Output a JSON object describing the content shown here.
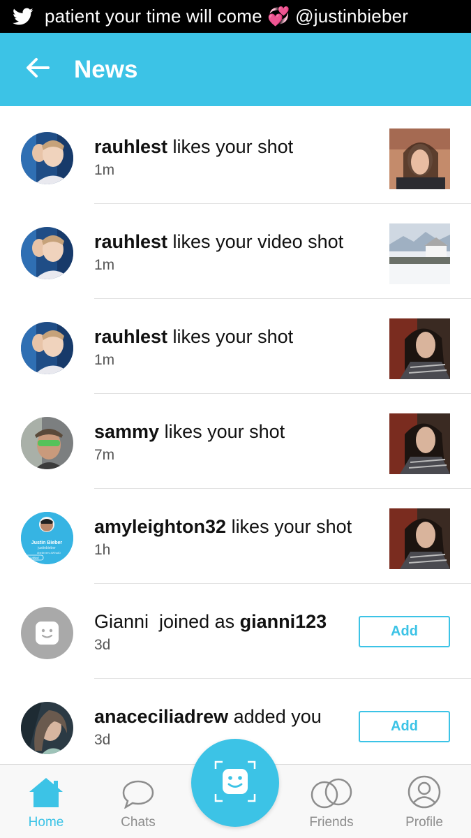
{
  "status_bar": {
    "icon": "twitter-bird-icon",
    "text": "patient your time will come 💞 @justinbieber"
  },
  "header": {
    "back_icon": "arrow-left-icon",
    "title": "News"
  },
  "feed": [
    {
      "user": "rauhlest",
      "action": " likes your shot",
      "time": "1m",
      "avatar": "photo-avatar",
      "trailing": "thumbnail"
    },
    {
      "user": "rauhlest",
      "action": " likes your video shot",
      "time": "1m",
      "avatar": "photo-avatar",
      "trailing": "thumbnail"
    },
    {
      "user": "rauhlest",
      "action": " likes your shot",
      "time": "1m",
      "avatar": "photo-avatar",
      "trailing": "thumbnail"
    },
    {
      "user": "sammy",
      "action": " likes your shot",
      "time": "7m",
      "avatar": "photo-avatar",
      "trailing": "thumbnail"
    },
    {
      "user": "amyleighton32",
      "action": " likes your shot",
      "time": "1h",
      "avatar": "photo-avatar",
      "trailing": "thumbnail",
      "avatar_text": {
        "name": "Justin Bieber",
        "handle": "justinbieber",
        "tag": "#believers #WhatD",
        "badge": "Added"
      }
    },
    {
      "prefix": "Gianni  joined as ",
      "user": "gianni123",
      "time": "3d",
      "avatar": "default-smiley-avatar",
      "trailing": "button",
      "button_label": "Add"
    },
    {
      "user": "anaceciliadrew",
      "action": " added you",
      "time": "3d",
      "avatar": "photo-avatar",
      "trailing": "button",
      "button_label": "Add"
    }
  ],
  "bottom_nav": {
    "items": [
      {
        "label": "Home",
        "icon": "home-icon",
        "active": true
      },
      {
        "label": "Chats",
        "icon": "chat-bubble-icon",
        "active": false
      },
      {
        "label": "Friends",
        "icon": "friends-circles-icon",
        "active": false
      },
      {
        "label": "Profile",
        "icon": "profile-icon",
        "active": false
      }
    ],
    "center_action_icon": "camera-smiley-icon"
  },
  "colors": {
    "accent": "#3cc3e6",
    "status_bar": "#000000",
    "inactive": "#8d8d8d"
  }
}
